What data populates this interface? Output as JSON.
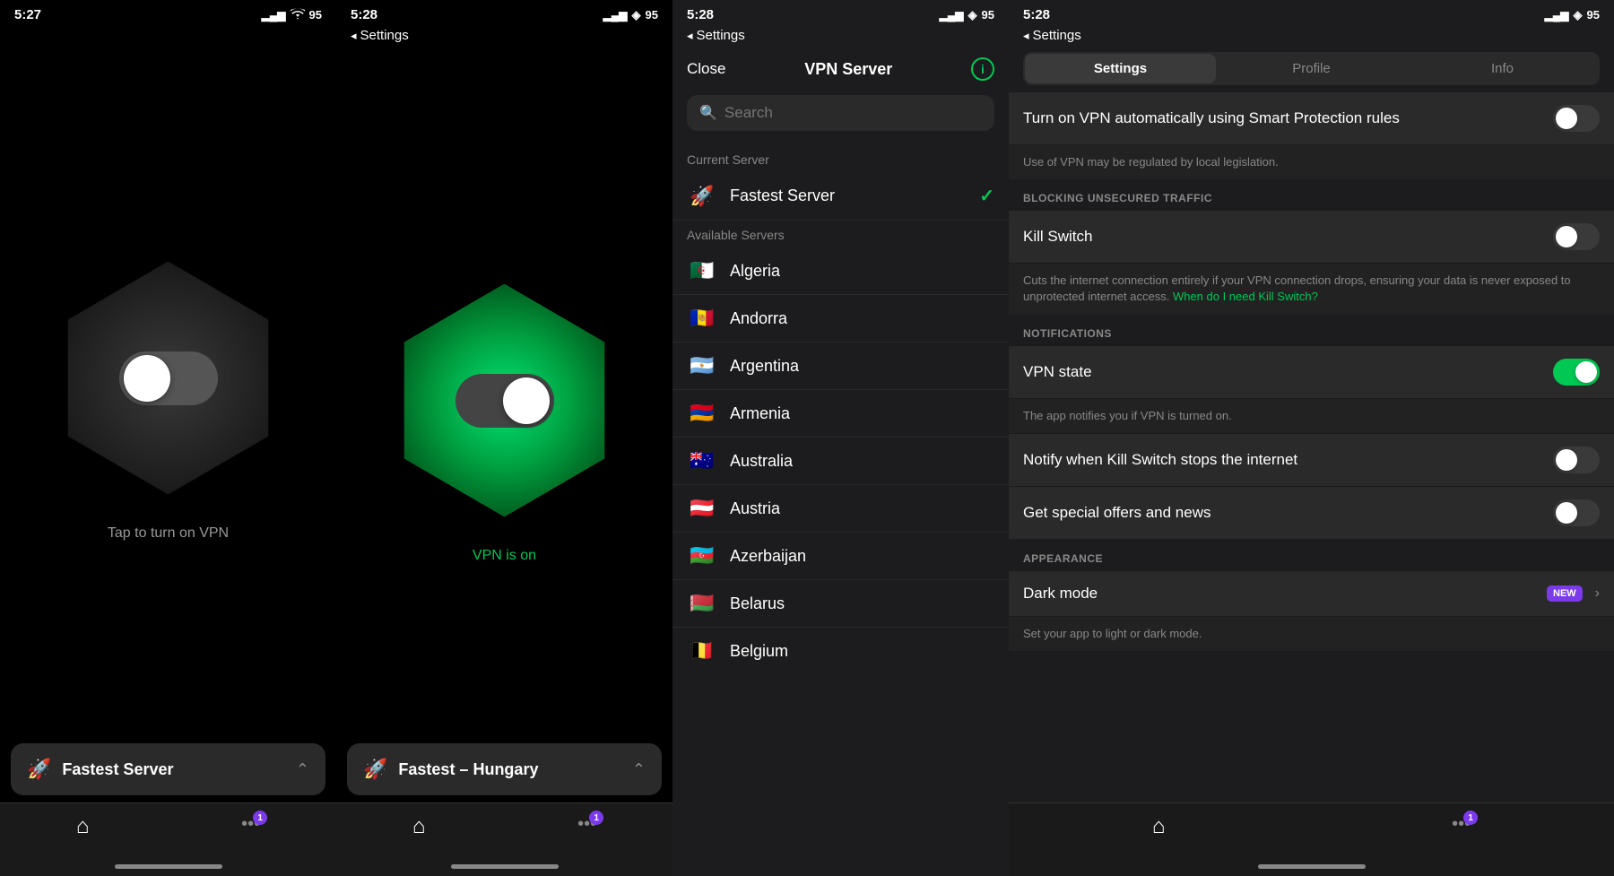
{
  "screens": {
    "screen1": {
      "statusBar": {
        "time": "5:27",
        "signal": "▂▄▆",
        "wifi": "wifi",
        "battery": "95"
      },
      "vpnStatus": "off",
      "toggleLabel": "Tap to turn on VPN",
      "serverBar": {
        "icon": "🚀",
        "name": "Fastest Server",
        "chevron": "⌃"
      },
      "tabs": [
        {
          "icon": "⌂",
          "badge": null
        },
        {
          "icon": "•••",
          "badge": "1"
        }
      ]
    },
    "screen2": {
      "statusBar": {
        "time": "5:28",
        "back": "Settings"
      },
      "vpnStatus": "on",
      "toggleLabel": "VPN is on",
      "serverBar": {
        "icon": "🚀",
        "name": "Fastest – Hungary",
        "chevron": "⌃"
      },
      "tabs": [
        {
          "icon": "⌂",
          "badge": null
        },
        {
          "icon": "•••",
          "badge": "1"
        }
      ]
    },
    "screen3": {
      "statusBar": {
        "time": "5:28",
        "back": "Settings"
      },
      "header": {
        "close": "Close",
        "title": "VPN Server",
        "info": "i"
      },
      "search": {
        "placeholder": "Search"
      },
      "currentSection": "Current Server",
      "currentServer": {
        "icon": "🚀",
        "name": "Fastest Server",
        "selected": true
      },
      "availableSection": "Available Servers",
      "servers": [
        {
          "flag": "🇩🇿",
          "name": "Algeria"
        },
        {
          "flag": "🇦🇩",
          "name": "Andorra"
        },
        {
          "flag": "🇦🇷",
          "name": "Argentina"
        },
        {
          "flag": "🇦🇲",
          "name": "Armenia"
        },
        {
          "flag": "🇦🇺",
          "name": "Australia"
        },
        {
          "flag": "🇦🇹",
          "name": "Austria"
        },
        {
          "flag": "🇦🇿",
          "name": "Azerbaijan"
        },
        {
          "flag": "🇧🇾",
          "name": "Belarus"
        },
        {
          "flag": "🇧🇪",
          "name": "Belgium"
        }
      ]
    },
    "screen4": {
      "statusBar": {
        "time": "5:28",
        "back": "Settings"
      },
      "tabs": [
        {
          "label": "Settings",
          "active": true
        },
        {
          "label": "Profile",
          "active": false
        },
        {
          "label": "Info",
          "active": false
        }
      ],
      "sections": [
        {
          "rows": [
            {
              "text": "Turn on VPN automatically using Smart Protection rules",
              "toggle": "off",
              "desc": "Use of VPN may be regulated by local legislation.",
              "descLink": null
            }
          ]
        },
        {
          "header": "BLOCKING UNSECURED TRAFFIC",
          "rows": [
            {
              "text": "Kill Switch",
              "toggle": "off",
              "desc": "Cuts the internet connection entirely if your VPN connection drops, ensuring your data is never exposed to unprotected internet access.",
              "descLink": "When do I need Kill Switch?"
            }
          ]
        },
        {
          "header": "NOTIFICATIONS",
          "rows": [
            {
              "text": "VPN state",
              "toggle": "on",
              "desc": "The app notifies you if VPN is turned on.",
              "descLink": null
            },
            {
              "text": "Notify when Kill Switch stops the internet",
              "toggle": "off",
              "desc": null,
              "descLink": null
            },
            {
              "text": "Get special offers and news",
              "toggle": "off",
              "desc": null,
              "descLink": null
            }
          ]
        },
        {
          "header": "APPEARANCE",
          "rows": [
            {
              "text": "Dark mode",
              "badge": "NEW",
              "chevron": true,
              "desc": "Set your app to light or dark mode.",
              "descLink": null
            }
          ]
        }
      ],
      "tabBar": {
        "home": "⌂",
        "menu": "•••",
        "badge": "1"
      }
    }
  }
}
